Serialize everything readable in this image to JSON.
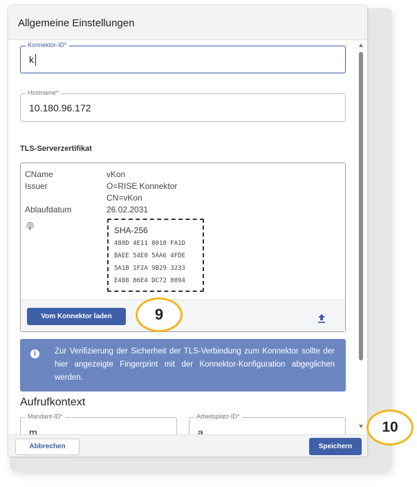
{
  "dialog": {
    "title": "Allgemeine Einstellungen"
  },
  "connector_id": {
    "label": "Konnektor-ID*",
    "value": "k"
  },
  "hostname": {
    "label": "Hostname*",
    "value": "10.180.96.172"
  },
  "tls": {
    "section_title": "TLS-Serverzertifikat",
    "rows": [
      {
        "label": "CName",
        "value": "vKon"
      },
      {
        "label": "Issuer",
        "value": "O=RISE Konnektor"
      },
      {
        "label": "",
        "value": "CN=vKon"
      },
      {
        "label": "Ablaufdatum",
        "value": "26.02.2031"
      }
    ],
    "fingerprint": {
      "algorithm": "SHA-256",
      "lines": [
        "480D 4E11 8010 FA1D",
        "BAEE 54E0 5AA6 4FDE",
        "5A1B 1F2A 9B29 3233",
        "E488 86E4 DC72 8094"
      ]
    },
    "load_button_label": "Vom Konnektor laden",
    "upload_icon": "upload-icon"
  },
  "info": {
    "icon": "info-icon",
    "text": "Zur Verifizierung der Sicherheit der TLS-Verbindung zum Konnektor sollte der hier angezeigte Fingerprint mit der Konnektor-Konfiguration abgeglichen werden."
  },
  "aufrufkontext": {
    "title": "Aufrufkontext",
    "mandant": {
      "label": "Mandant-ID*",
      "value": "m"
    },
    "arbeitsplatz": {
      "label": "Arbeitsplatz-ID*",
      "value": "a"
    }
  },
  "footer": {
    "cancel_label": "Abbrechen",
    "save_label": "Speichern"
  },
  "callouts": {
    "load": "9",
    "save": "10"
  },
  "colors": {
    "primary": "#3f5fa8",
    "info_banner": "#6b86c1",
    "callout_ring": "#f2b61c"
  }
}
